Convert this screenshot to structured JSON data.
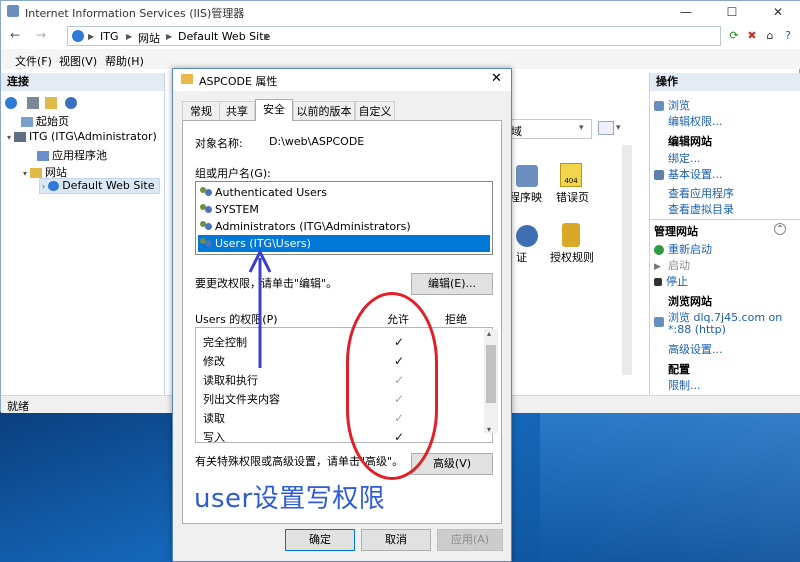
{
  "window": {
    "title": "Internet Information Services (IIS)管理器",
    "controls": {
      "minimize": "—",
      "maximize": "☐",
      "close": "✕"
    }
  },
  "address": {
    "crumbs": [
      "ITG",
      "网站",
      "Default Web Site"
    ],
    "sep": "▶"
  },
  "menu": {
    "items": [
      "文件(F)",
      "视图(V)",
      "帮助(H)"
    ]
  },
  "left_pane": {
    "header": "连接",
    "tree": [
      {
        "label": "起始页",
        "indent": 0
      },
      {
        "label": "ITG (ITG\\Administrator)",
        "indent": 0
      },
      {
        "label": "应用程序池",
        "indent": 1
      },
      {
        "label": "网站",
        "indent": 1
      },
      {
        "label": "Default Web Site",
        "indent": 2
      }
    ]
  },
  "center": {
    "filter_tail": "域",
    "icons": [
      {
        "label": "程序映",
        "sub": ""
      },
      {
        "label": "错误页",
        "sub": "404"
      },
      {
        "label": "证",
        "sub": ""
      },
      {
        "label": "授权规则",
        "sub": ""
      }
    ]
  },
  "right_pane": {
    "header": "操作",
    "items": [
      {
        "text": "浏览",
        "kind": "link"
      },
      {
        "text": "编辑权限...",
        "kind": "link"
      },
      {
        "text": "编辑网站",
        "kind": "head"
      },
      {
        "text": "绑定...",
        "kind": "link"
      },
      {
        "text": "基本设置...",
        "kind": "link"
      },
      {
        "text": "查看应用程序",
        "kind": "link"
      },
      {
        "text": "查看虚拟目录",
        "kind": "link"
      },
      {
        "text": "管理网站",
        "kind": "head"
      },
      {
        "text": "重新启动",
        "kind": "link"
      },
      {
        "text": "启动",
        "kind": "dim"
      },
      {
        "text": "停止",
        "kind": "link"
      },
      {
        "text": "浏览网站",
        "kind": "head"
      },
      {
        "text": "浏览 dlq.7j45.com on",
        "kind": "link"
      },
      {
        "text": "*:88 (http)",
        "kind": "link"
      },
      {
        "text": "高级设置...",
        "kind": "link"
      },
      {
        "text": "配置",
        "kind": "head"
      },
      {
        "text": "限制...",
        "kind": "link"
      }
    ]
  },
  "status": {
    "text": "就绪"
  },
  "dialog": {
    "title": "ASPCODE 属性",
    "tabs": [
      "常规",
      "共享",
      "安全",
      "以前的版本",
      "自定义"
    ],
    "active_tab": "安全",
    "object_label": "对象名称:",
    "object_value": "D:\\web\\ASPCODE",
    "group_label": "组或用户名(G):",
    "users": [
      "Authenticated Users",
      "SYSTEM",
      "Administrators (ITG\\Administrators)",
      "Users (ITG\\Users)"
    ],
    "selected_user": "Users (ITG\\Users)",
    "change_hint": "要更改权限，请单击\"编辑\"。",
    "edit_button": "编辑(E)...",
    "perm_label": "Users 的权限(P)",
    "allow_col": "允许",
    "deny_col": "拒绝",
    "permissions": [
      {
        "name": "完全控制",
        "allow": "✓",
        "dark": true
      },
      {
        "name": "修改",
        "allow": "✓",
        "dark": true
      },
      {
        "name": "读取和执行",
        "allow": "✓",
        "dark": false
      },
      {
        "name": "列出文件夹内容",
        "allow": "✓",
        "dark": false
      },
      {
        "name": "读取",
        "allow": "✓",
        "dark": false
      },
      {
        "name": "写入",
        "allow": "✓",
        "dark": true
      }
    ],
    "special_hint": "有关特殊权限或高级设置，请单击\"高级\"。",
    "advanced_button": "高级(V)",
    "ok": "确定",
    "cancel": "取消",
    "apply": "应用(A)"
  },
  "annotation": {
    "text": "user设置写权限",
    "arrow_color": "#3b3fd1",
    "oval_color": "#e01f26"
  }
}
